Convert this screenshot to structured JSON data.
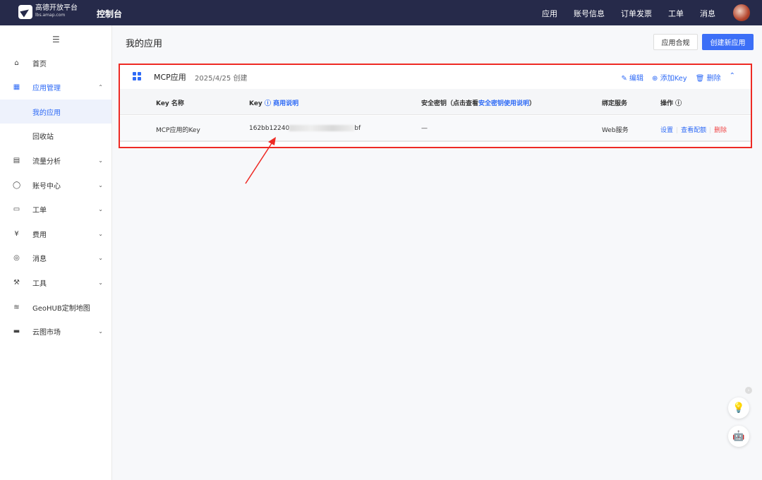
{
  "topbar": {
    "logo_text": "高德开放平台",
    "logo_sub": "lbs.amap.com",
    "console": "控制台",
    "nav": [
      "应用",
      "账号信息",
      "订单发票",
      "工单",
      "消息"
    ]
  },
  "sidebar": {
    "items": [
      {
        "label": "首页",
        "icon": "home-icon",
        "chevron": ""
      },
      {
        "label": "应用管理",
        "icon": "grid-icon",
        "chevron": "⌃"
      },
      {
        "label": "我的应用",
        "icon": "",
        "chevron": ""
      },
      {
        "label": "回收站",
        "icon": "",
        "chevron": ""
      },
      {
        "label": "流量分析",
        "icon": "chart-icon",
        "chevron": "⌄"
      },
      {
        "label": "账号中心",
        "icon": "user-icon",
        "chevron": "⌄"
      },
      {
        "label": "工单",
        "icon": "ticket-icon",
        "chevron": "⌄"
      },
      {
        "label": "费用",
        "icon": "money-icon",
        "chevron": "⌄"
      },
      {
        "label": "消息",
        "icon": "message-icon",
        "chevron": "⌄"
      },
      {
        "label": "工具",
        "icon": "wrench-icon",
        "chevron": "⌄"
      },
      {
        "label": "GeoHUB定制地图",
        "icon": "layers-icon",
        "chevron": ""
      },
      {
        "label": "云图市场",
        "icon": "store-icon",
        "chevron": "⌄"
      }
    ]
  },
  "main": {
    "title": "我的应用",
    "btn_compliance": "应用合规",
    "btn_create": "创建新应用"
  },
  "app": {
    "name": "MCP应用",
    "date": "2025/4/25 创建",
    "edit": "编辑",
    "add_key": "添加Key",
    "delete": "删除",
    "headers": {
      "key_name": "Key 名称",
      "key": "Key",
      "key_link": "商用说明",
      "secret": "安全密钥（点击查看",
      "secret_link": "安全密钥使用说明",
      "secret_end": "）",
      "service": "绑定服务",
      "ops": "操作"
    },
    "rows": [
      {
        "key_name": "MCP应用的Key",
        "key_prefix": "162bb12240",
        "key_suffix": "bf",
        "secret": "—",
        "service": "Web服务",
        "op_set": "设置",
        "op_quota": "查看配额",
        "op_del": "删除"
      }
    ]
  },
  "colors": {
    "accent": "#2f6bf6",
    "topbar": "#262a4a",
    "highlight": "#ee2a24"
  }
}
